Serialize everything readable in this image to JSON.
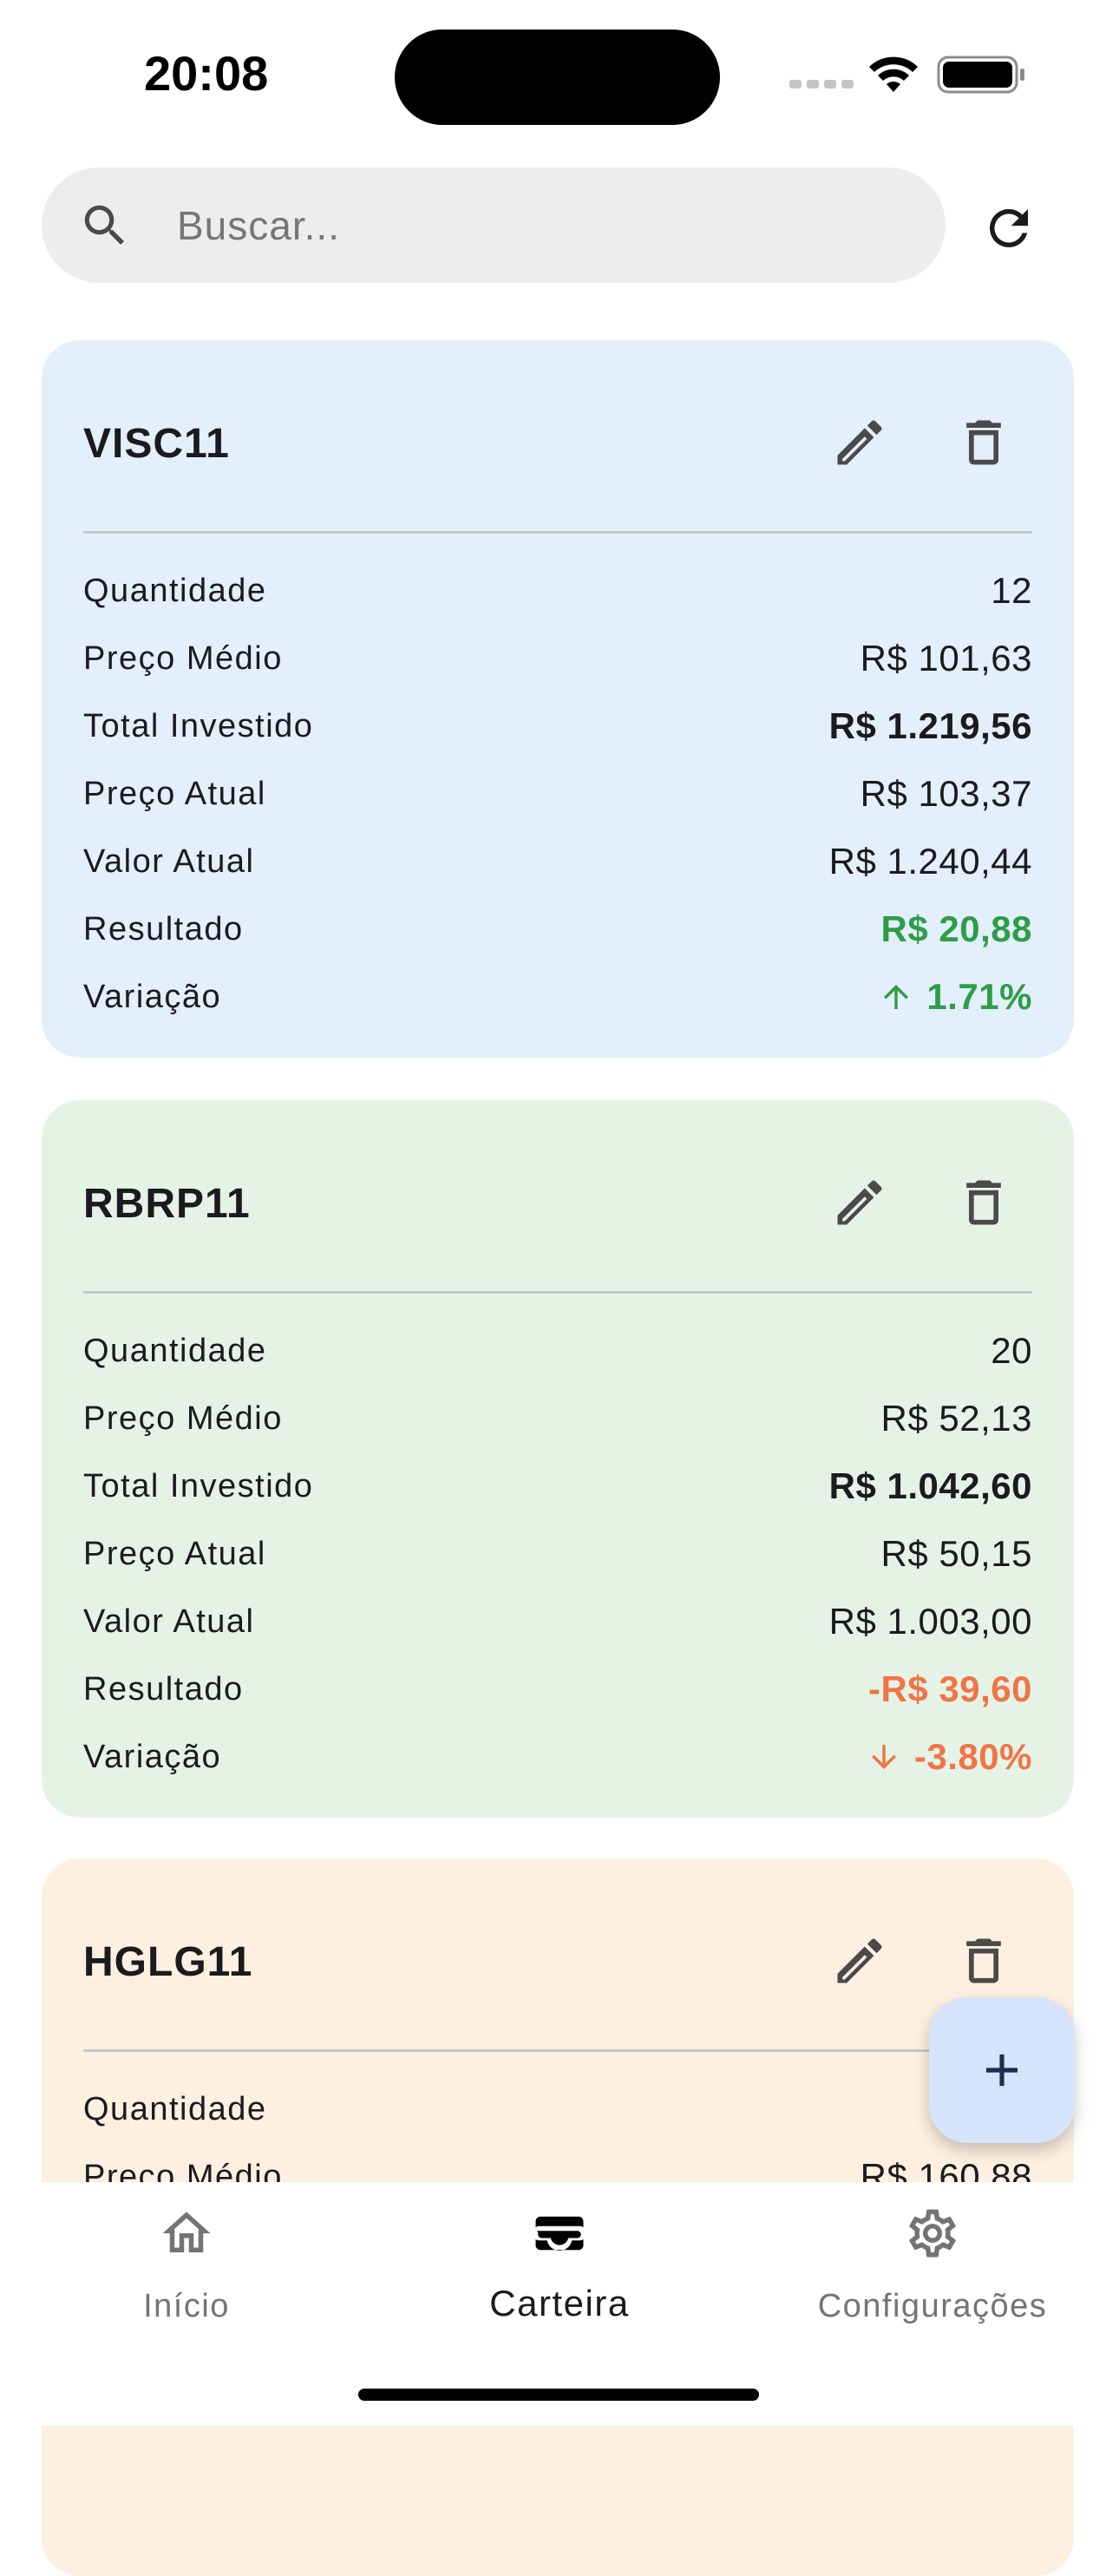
{
  "status": {
    "time": "20:08"
  },
  "search": {
    "placeholder": "Buscar..."
  },
  "labels": {
    "quantidade": "Quantidade",
    "preco_medio": "Preço Médio",
    "total_investido": "Total Investido",
    "preco_atual": "Preço Atual",
    "valor_atual": "Valor Atual",
    "resultado": "Resultado",
    "variacao": "Variação"
  },
  "cards": [
    {
      "ticker": "VISC11",
      "background": "#e3effb",
      "quantidade": "12",
      "preco_medio": "R$ 101,63",
      "total_investido": "R$ 1.219,56",
      "preco_atual": "R$ 103,37",
      "valor_atual": "R$ 1.240,44",
      "resultado": "R$ 20,88",
      "variacao": "1.71%",
      "trend": "up",
      "trend_color": "#2e9d48"
    },
    {
      "ticker": "RBRP11",
      "background": "#e5f3e7",
      "quantidade": "20",
      "preco_medio": "R$ 52,13",
      "total_investido": "R$ 1.042,60",
      "preco_atual": "R$ 50,15",
      "valor_atual": "R$ 1.003,00",
      "resultado": "-R$ 39,60",
      "variacao": "-3.80%",
      "trend": "down",
      "trend_color": "#f07545"
    },
    {
      "ticker": "HGLG11",
      "background": "#fdf0e0",
      "quantidade": "",
      "preco_medio": "R$ 160,88"
    }
  ],
  "nav": {
    "items": [
      {
        "label": "Início",
        "icon": "home-icon"
      },
      {
        "label": "Carteira",
        "icon": "wallet-icon"
      },
      {
        "label": "Configurações",
        "icon": "settings-icon"
      }
    ],
    "active_index": 1
  },
  "icons": {
    "search": "search-icon",
    "refresh": "refresh-icon",
    "edit": "edit-icon",
    "delete": "trash-icon",
    "add": "plus-icon",
    "trend_up": "arrow-up-icon",
    "trend_down": "arrow-down-icon"
  }
}
